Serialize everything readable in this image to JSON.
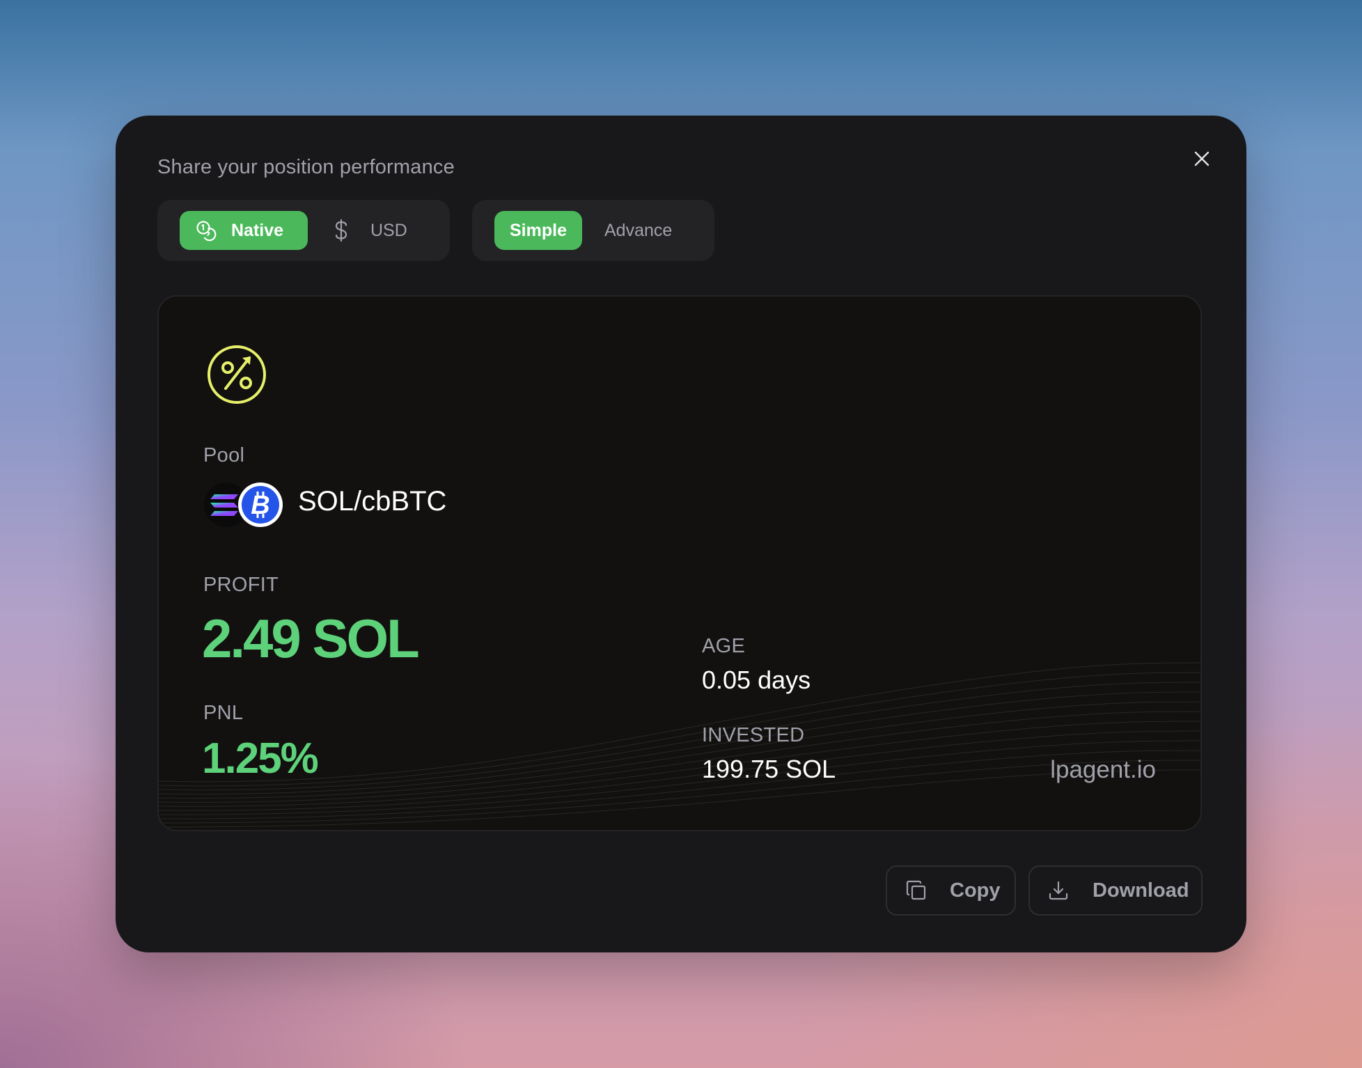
{
  "modal": {
    "title": "Share your position performance",
    "close_icon": "close-icon"
  },
  "currency_toggle": {
    "options": [
      {
        "label": "Native",
        "icon": "coins-icon",
        "active": true
      },
      {
        "label": "USD",
        "icon": "dollar-icon",
        "active": false
      }
    ]
  },
  "mode_toggle": {
    "options": [
      {
        "label": "Simple",
        "active": true
      },
      {
        "label": "Advance",
        "active": false
      }
    ]
  },
  "card": {
    "icon": "percent-up-icon",
    "pool_label": "Pool",
    "pool_name": "SOL/cbBTC",
    "pool_token_icons": [
      "solana-icon",
      "bitcoin-icon"
    ],
    "profit_label": "PROFIT",
    "profit_value": "2.49 SOL",
    "pnl_label": "PNL",
    "pnl_value": "1.25%",
    "age_label": "AGE",
    "age_value": "0.05 days",
    "invested_label": "INVESTED",
    "invested_value": "199.75 SOL",
    "brand": "lpagent.io"
  },
  "actions": {
    "copy_label": "Copy",
    "copy_icon": "copy-icon",
    "download_label": "Download",
    "download_icon": "download-icon"
  },
  "colors": {
    "accent_green": "#4bb95b",
    "value_green": "#5ed27a",
    "icon_yellow": "#e6f06a",
    "modal_bg": "#18181b",
    "card_bg": "#121110",
    "muted_text": "#a1a1aa"
  }
}
